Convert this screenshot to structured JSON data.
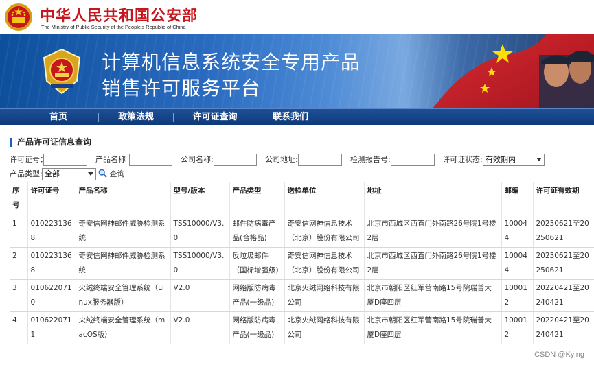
{
  "header": {
    "ministry_cn": "中华人民共和国公安部",
    "ministry_en": "The Ministry of Public Security of the People's Republic of China"
  },
  "banner": {
    "title_line1": "计算机信息系统安全专用产品",
    "title_line2": "销售许可服务平台"
  },
  "nav": {
    "items": [
      {
        "label": "首页"
      },
      {
        "label": "政策法规"
      },
      {
        "label": "许可证查询"
      },
      {
        "label": "联系我们"
      }
    ]
  },
  "section": {
    "title": "产品许可证信息查询"
  },
  "search": {
    "license_no_label": "许可证号：",
    "product_name_label": "产品名称",
    "company_name_label": "公司名称:",
    "company_addr_label": "公司地址:",
    "report_no_label": "检测报告号:",
    "license_status_label": "许可证状态:",
    "license_status_value": "有效期内",
    "product_type_label": "产品类型:",
    "product_type_value": "全部",
    "query_label": "查询"
  },
  "table": {
    "headers": [
      "序号",
      "许可证号",
      "产品名称",
      "型号/版本",
      "产品类型",
      "送检单位",
      "地址",
      "邮编",
      "许可证有效期"
    ],
    "rows": [
      [
        "1",
        "0102231368",
        "奇安信网神邮件威胁检测系统",
        "TSS10000/V3.0",
        "邮件防病毒产品(合格品)",
        "奇安信网神信息技术（北京）股份有限公司",
        "北京市西城区西直门外南路26号院1号楼2层",
        "100044",
        "20230621至20250621"
      ],
      [
        "2",
        "0102231368",
        "奇安信网神邮件威胁检测系统",
        "TSS10000/V3.0",
        "反垃圾邮件（国标增强级)",
        "奇安信网神信息技术（北京）股份有限公司",
        "北京市西城区西直门外南路26号院1号楼2层",
        "100044",
        "20230621至20250621"
      ],
      [
        "3",
        "0106220710",
        "火绒终端安全管理系统（Linux服务器版）",
        "V2.0",
        "网络版防病毒产品(一级品)",
        "北京火绒网络科技有限公司",
        "北京市朝阳区红军营南路15号院瑞普大厦D座四层",
        "100012",
        "20220421至20240421"
      ],
      [
        "4",
        "0106220711",
        "火绒终端安全管理系统（macOS版）",
        "V2.0",
        "网络版防病毒产品(一级品)",
        "北京火绒网络科技有限公司",
        "北京市朝阳区红军营南路15号院瑞普大厦D座四层",
        "100012",
        "20220421至20240421"
      ]
    ]
  },
  "watermark": "CSDN @Kying"
}
